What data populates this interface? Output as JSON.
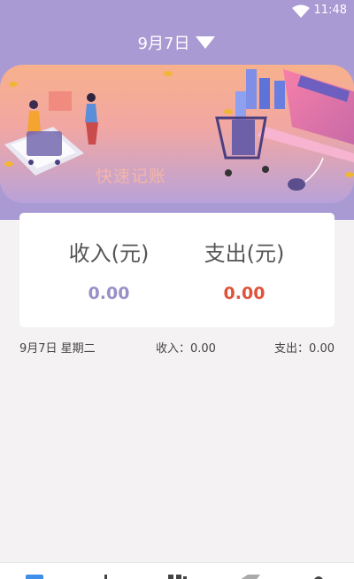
{
  "status_bar": {
    "time": "11:48"
  },
  "header": {
    "date": "9月7日"
  },
  "banner": {
    "text": "快速记账"
  },
  "summary": {
    "income_label": "收入(元)",
    "income_value": "0.00",
    "expense_label": "支出(元)",
    "expense_value": "0.00"
  },
  "day_row": {
    "date": "9月7日 星期二",
    "income": "收入：0.00",
    "expense": "支出：0.00"
  },
  "colors": {
    "header_bg": "#a99ad4",
    "income": "#9a90c8",
    "expense": "#e0533a",
    "tab_active": "#3f8ee8"
  },
  "tab_bar": {
    "icons": [
      "ledger-icon",
      "add-icon",
      "stats-icon",
      "bill-icon",
      "profile-icon"
    ]
  }
}
